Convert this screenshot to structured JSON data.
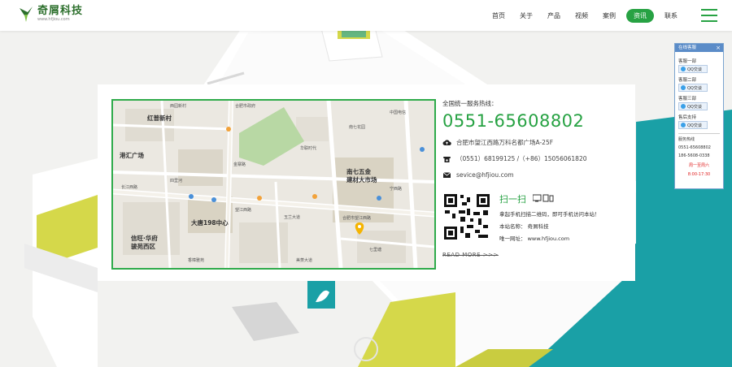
{
  "brand": {
    "name": "奇屑科技",
    "url": "www.hfjiou.com",
    "accent": "#27a243"
  },
  "nav": {
    "items": [
      "首页",
      "关于",
      "产品",
      "视频",
      "案例",
      "资讯",
      "联系"
    ],
    "active_index": 5
  },
  "map": {
    "labels": [
      "红普新村",
      "港汇广场",
      "大唐198中心",
      "信旺·华府",
      "骏苑西区",
      "南七五金",
      "建材大市场",
      "七里塘",
      "华联时代",
      "合肥市望江西路",
      "西园新村",
      "望江西路",
      "香樟雅苑",
      "中国电信",
      "合肥市政府",
      "南七花园",
      "长江西路",
      "玉兰大道",
      "宁西路",
      "金寨路",
      "美菱大道",
      "四里河"
    ]
  },
  "contact": {
    "hotline_label": "全国统一服务热线：",
    "hotline": "0551-65608802",
    "address": "合肥市望江西路万科名都广场A-25F",
    "phone": "（0551）68199125 /（+86）15056061820",
    "email": "sevice@hfjiou.com",
    "scan_title": "扫一扫",
    "scan_desc": "拿起手机扫描二维码，即可手机访问本站！",
    "site_name": "本站名称：  奇屑科技",
    "site_url": "唯一网址：  www.hfjiou.com",
    "read_more": "READ MORE >>>"
  },
  "qq_panel": {
    "title": "在线客服",
    "close": "×",
    "depts": [
      {
        "name": "客服一部",
        "btn": "QQ交谈"
      },
      {
        "name": "客服二部",
        "btn": "QQ交谈"
      },
      {
        "name": "客服三部",
        "btn": "QQ交谈"
      },
      {
        "name": "售后支持",
        "btn": "QQ交谈"
      }
    ],
    "hotline_title": "服务热线",
    "numbers": [
      "0551-65608802",
      "186-5608-0338"
    ],
    "hours": "周一至周六",
    "time": "8:00-17:30"
  }
}
